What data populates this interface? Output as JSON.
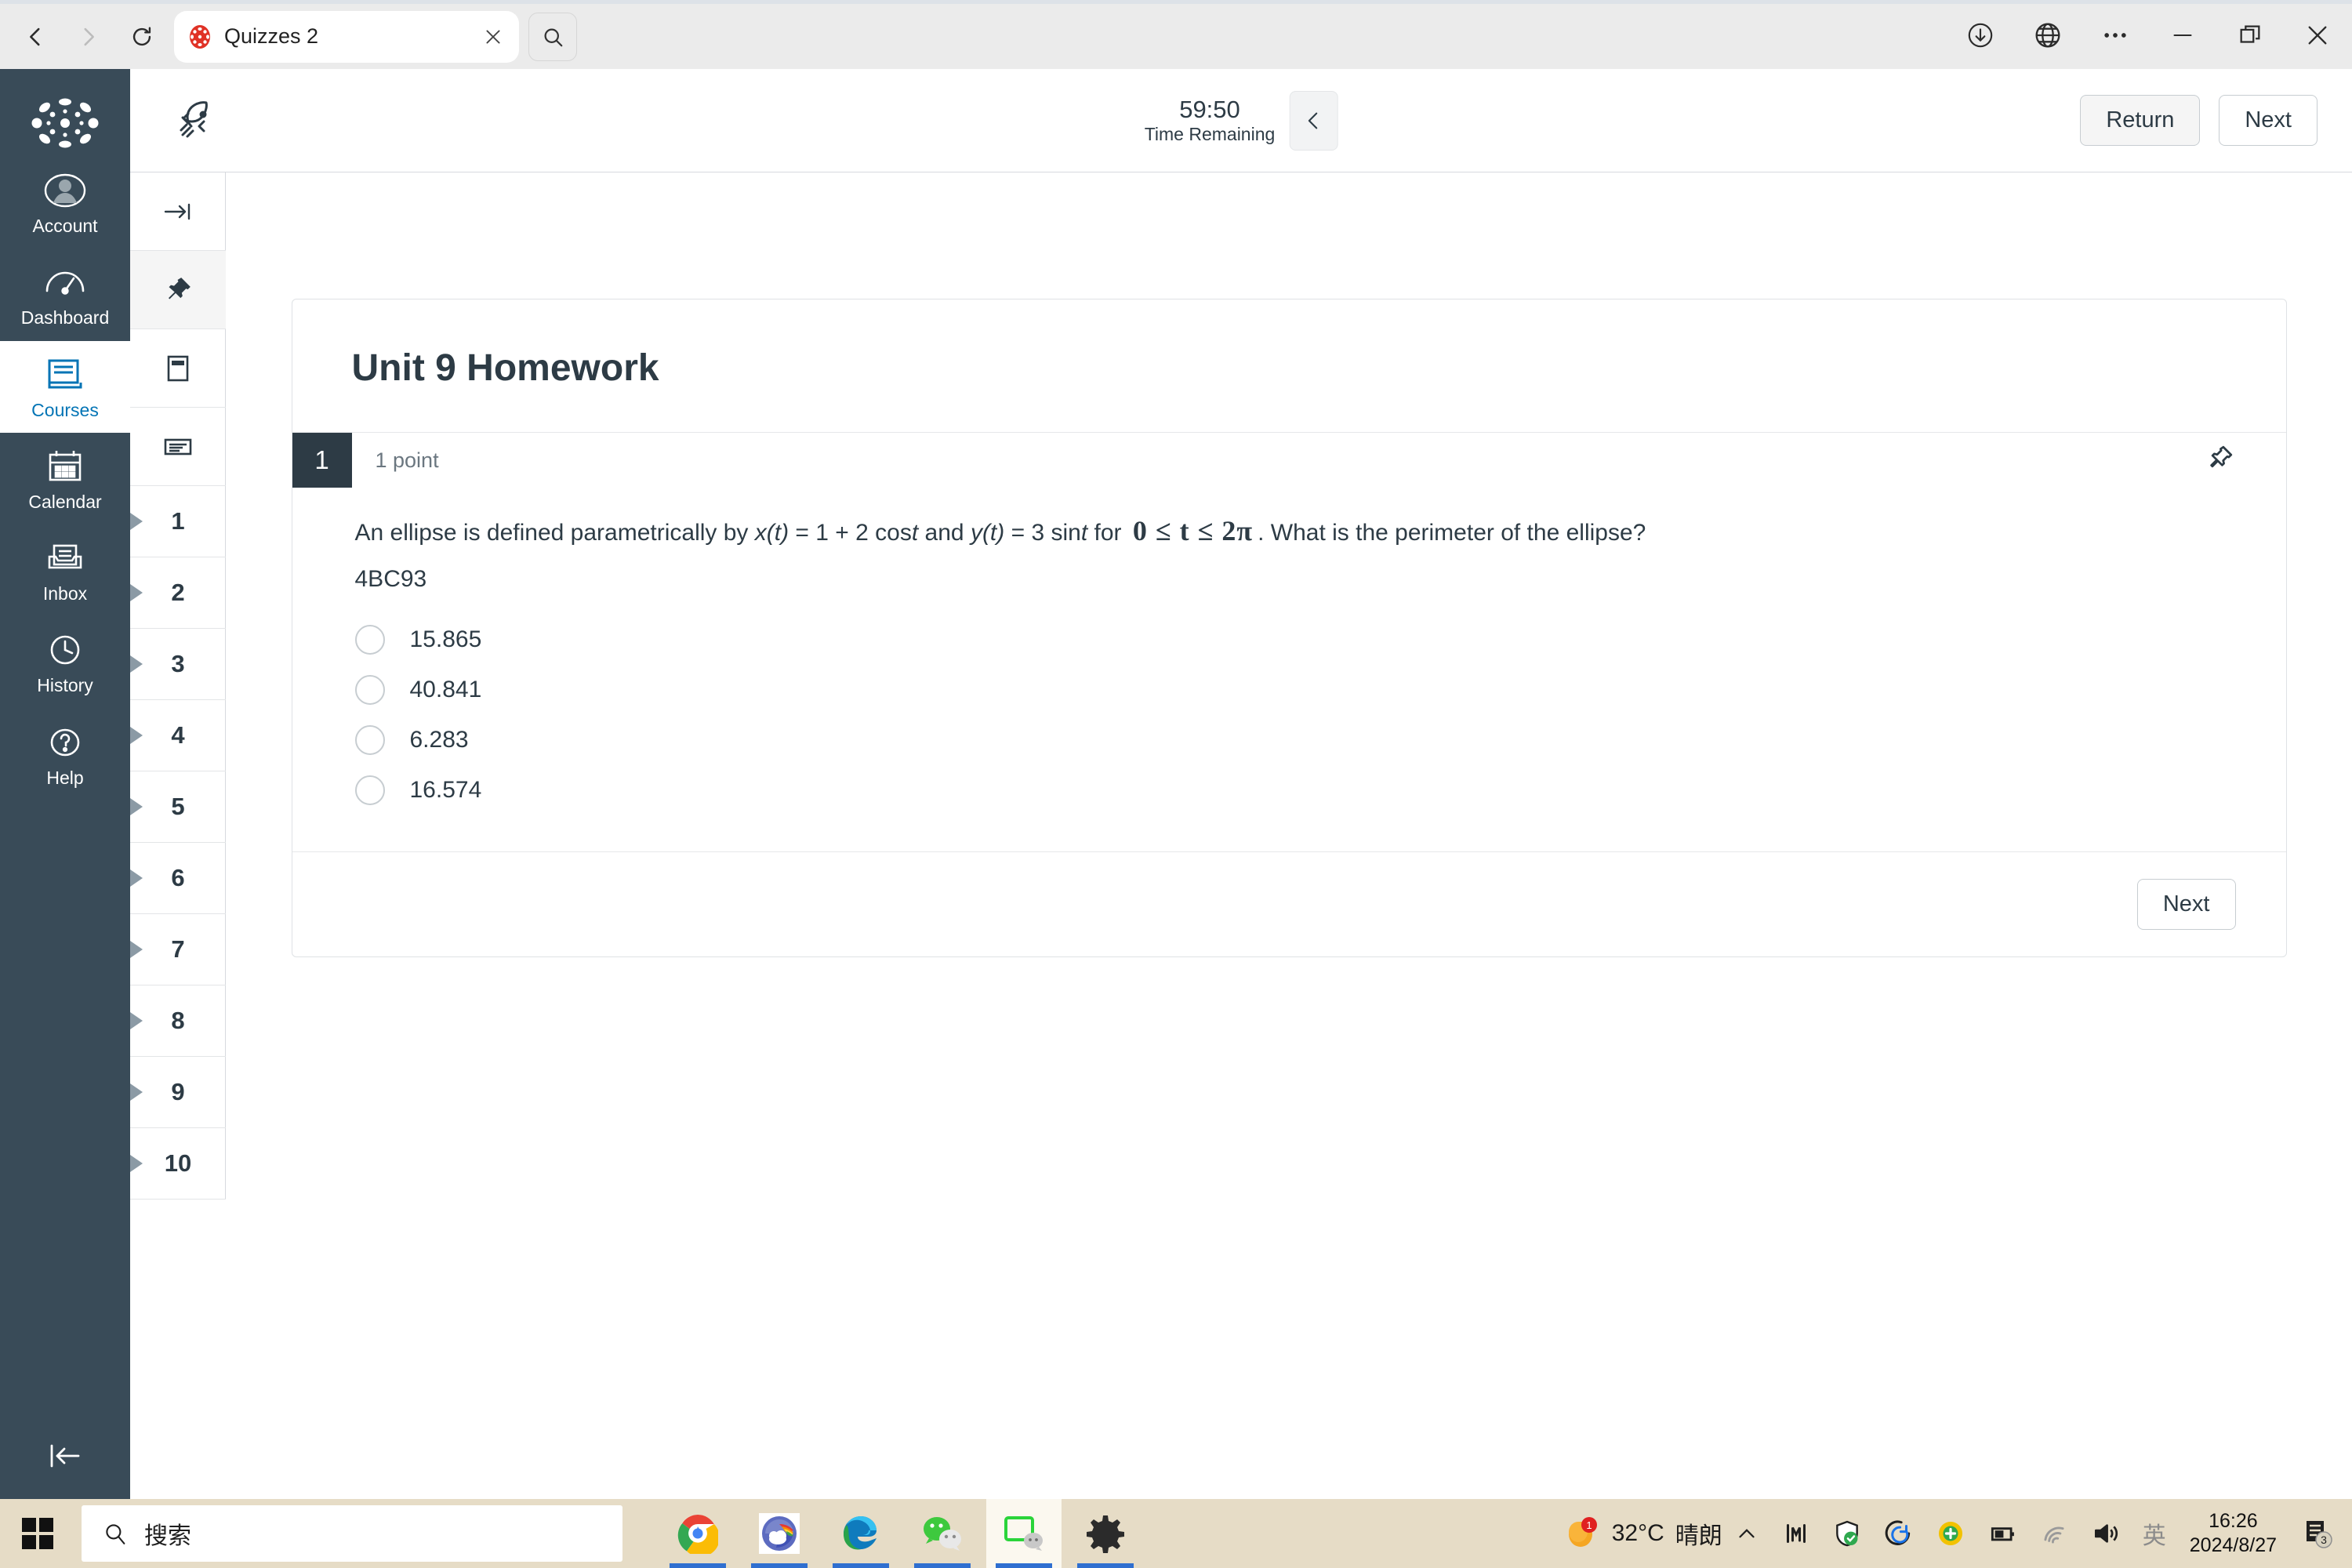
{
  "browser": {
    "back_icon": "back-arrow-icon",
    "forward_icon": "forward-arrow-icon",
    "reload_icon": "reload-icon",
    "tab_title": "Quizzes 2",
    "tab_favicon": "canvas-logo-icon",
    "tab_close_icon": "close-icon",
    "tab_search_icon": "search-icon",
    "window_controls": [
      {
        "name": "downloads-icon",
        "glyph": "download"
      },
      {
        "name": "translate-globe-icon",
        "glyph": "globe"
      },
      {
        "name": "more-options-icon",
        "glyph": "ellipsis"
      },
      {
        "name": "minimize-icon",
        "glyph": "minimize"
      },
      {
        "name": "maximize-icon",
        "glyph": "maximize"
      },
      {
        "name": "close-window-icon",
        "glyph": "close"
      }
    ]
  },
  "global_nav": {
    "logo": "canvas-logo",
    "items": [
      {
        "label": "Account",
        "icon": "user-avatar-icon",
        "active": false
      },
      {
        "label": "Dashboard",
        "icon": "dashboard-gauge-icon",
        "active": false
      },
      {
        "label": "Courses",
        "icon": "courses-book-icon",
        "active": true
      },
      {
        "label": "Calendar",
        "icon": "calendar-icon",
        "active": false
      },
      {
        "label": "Inbox",
        "icon": "inbox-tray-icon",
        "active": false
      },
      {
        "label": "History",
        "icon": "clock-history-icon",
        "active": false
      },
      {
        "label": "Help",
        "icon": "question-mark-help-icon",
        "active": false
      }
    ],
    "collapse_icon": "collapse-left-icon"
  },
  "quiz_topbar": {
    "rocket_icon": "rocket-icon",
    "timer_value": "59:50",
    "timer_label": "Time Remaining",
    "timer_toggle_icon": "chevron-left-icon",
    "return_label": "Return",
    "next_label": "Next"
  },
  "question_nav": {
    "tools": [
      {
        "name": "expand-right-icon",
        "label": ""
      },
      {
        "name": "pin-icon",
        "label": "",
        "pinned": true
      },
      {
        "name": "question-card-icon",
        "label": ""
      },
      {
        "name": "list-view-icon",
        "label": ""
      }
    ],
    "questions": [
      {
        "number": "1"
      },
      {
        "number": "2"
      },
      {
        "number": "3"
      },
      {
        "number": "4"
      },
      {
        "number": "5"
      },
      {
        "number": "6"
      },
      {
        "number": "7"
      },
      {
        "number": "8"
      },
      {
        "number": "9"
      },
      {
        "number": "10"
      }
    ]
  },
  "quiz": {
    "title": "Unit 9 Homework",
    "question": {
      "number": "1",
      "points": "1 point",
      "pin_icon": "pin-icon",
      "text_part1": "An ellipse is defined parametrically by ",
      "text_x": "x(t)",
      "text_part2": " = 1 + 2 cos",
      "text_t1": "t",
      "text_part3": " and ",
      "text_y": "y(t)",
      "text_part4": " = 3 sin",
      "text_t2": "t",
      "text_part5": " for ",
      "math": "0 ≤ t ≤ 2π",
      "text_part6": ". What is the perimeter of the ellipse?",
      "code": "4BC93",
      "answers": [
        {
          "label": "15.865",
          "selected": false
        },
        {
          "label": "40.841",
          "selected": false
        },
        {
          "label": "6.283",
          "selected": false
        },
        {
          "label": "16.574",
          "selected": false
        }
      ],
      "next_label": "Next"
    }
  },
  "taskbar": {
    "start_icon": "windows-start-icon",
    "search_icon": "search-icon",
    "search_placeholder": "搜索",
    "apps": [
      {
        "name": "chrome-taskbar-icon",
        "running": true,
        "active": false
      },
      {
        "name": "weather-taskbar-icon",
        "running": true,
        "active": false
      },
      {
        "name": "edge-taskbar-icon",
        "running": true,
        "active": false
      },
      {
        "name": "wechat-taskbar-icon",
        "running": true,
        "active": false
      },
      {
        "name": "wechat-devtools-taskbar-icon",
        "running": true,
        "active": true
      },
      {
        "name": "settings-taskbar-icon",
        "running": true,
        "active": false
      }
    ],
    "tray": {
      "weather_temp": "32°C",
      "weather_desc": "晴朗",
      "weather_badge": "1",
      "overflow_icon": "chevron-up-icon",
      "icons": [
        {
          "name": "network-monitor-icon"
        },
        {
          "name": "security-shield-icon"
        },
        {
          "name": "sync-icon"
        },
        {
          "name": "plus-circle-icon"
        },
        {
          "name": "battery-icon"
        },
        {
          "name": "wifi-icon"
        },
        {
          "name": "volume-icon"
        }
      ],
      "ime_label": "英",
      "time": "16:26",
      "date": "2024/8/27",
      "notification_icon": "notification-icon",
      "notification_count": "3"
    }
  },
  "colors": {
    "canvas_dark": "#394b58",
    "canvas_link": "#0374b5",
    "text_dark": "#2d3b45",
    "taskbar_bg": "#e6dcc6"
  }
}
